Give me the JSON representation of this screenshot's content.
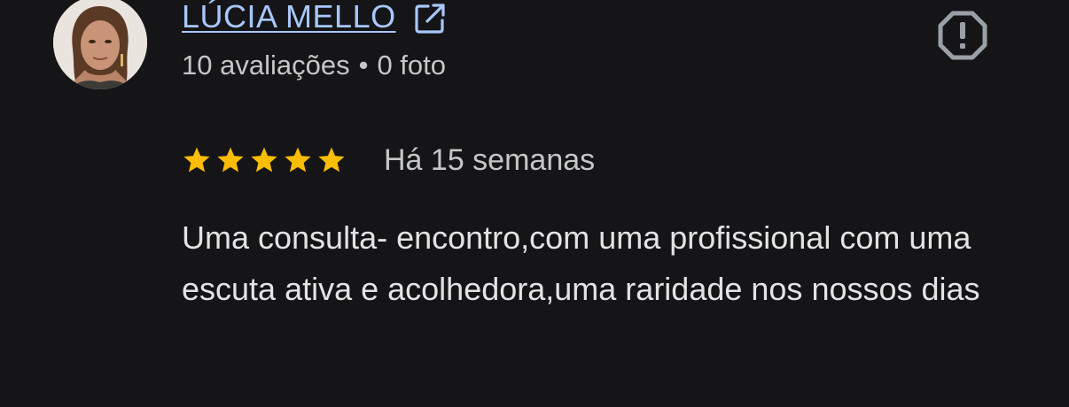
{
  "reviewer": {
    "name": "LÚCIA MELLO",
    "reviews_count": "10 avaliações",
    "separator": "•",
    "photos_count": "0 foto",
    "avatar_icon": "profile-photo"
  },
  "icons": {
    "external_link": "open-in-new-icon",
    "report": "report-icon"
  },
  "rating": {
    "stars": 5,
    "max_stars": 5,
    "star_color": "#fbbc04"
  },
  "timestamp": "Há 15 semanas",
  "review": {
    "text": "Uma consulta- encontro,com uma profissional com uma escuta ativa e acolhedora,uma raridade nos nossos dias"
  },
  "colors": {
    "background": "#151518",
    "link": "#a8c7fa",
    "secondary_text": "#c4c7c5",
    "primary_text": "#e3e3e3",
    "report_icon": "#9aa0a6"
  }
}
